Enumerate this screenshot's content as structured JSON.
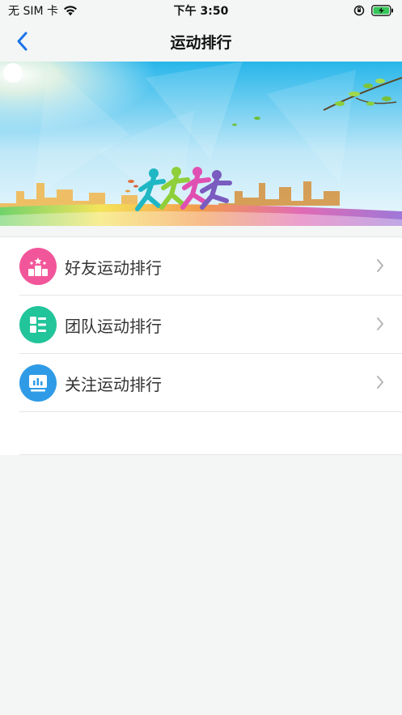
{
  "status_bar": {
    "carrier": "无 SIM 卡",
    "time": "下午 3:50"
  },
  "nav": {
    "title": "运动排行",
    "back_icon": "chevron-left-icon"
  },
  "banner": {
    "image": "runners-city-sunrise-banner"
  },
  "menu": {
    "items": [
      {
        "label": "好友运动排行",
        "icon": "podium-icon",
        "color": "#f2569a"
      },
      {
        "label": "团队运动排行",
        "icon": "grid-list-icon",
        "color": "#22c49a"
      },
      {
        "label": "关注运动排行",
        "icon": "monitor-chart-icon",
        "color": "#2f9be6"
      }
    ]
  },
  "colors": {
    "accent": "#1a73e8",
    "background": "#f4f6f5"
  }
}
